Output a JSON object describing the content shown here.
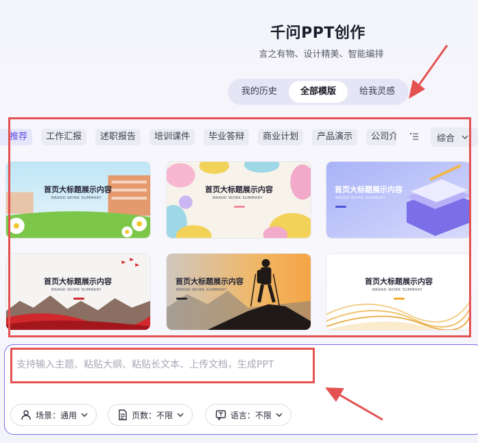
{
  "header": {
    "title": "千问PPT创作",
    "subtitle": "言之有物、设计精美、智能编排"
  },
  "tabs": [
    {
      "label": "我的历史",
      "active": false
    },
    {
      "label": "全部模版",
      "active": true
    },
    {
      "label": "给我灵感",
      "active": false
    }
  ],
  "categories": [
    "推荐",
    "工作汇报",
    "述职报告",
    "培训课件",
    "毕业答辩",
    "商业计划",
    "产品演示",
    "公司介"
  ],
  "sort": {
    "label": "综合"
  },
  "templates": [
    {
      "title": "首页大标题展示内容",
      "subtitle": "BRAND WORK SUMMARY",
      "theme": "school-campus"
    },
    {
      "title": "首页大标题展示内容",
      "subtitle": "BRAND WORK SUMMARY",
      "theme": "pastel-cartoon"
    },
    {
      "title": "首页大标题展示内容",
      "subtitle": "BRAND WORK SUMMARY",
      "theme": "purple-books"
    },
    {
      "title": "首页大标题展示内容",
      "subtitle": "BRAND WORK SUMMARY",
      "theme": "red-mountains"
    },
    {
      "title": "首页大标题展示内容",
      "subtitle": "BRAND WORK SUMMARY",
      "theme": "mountain-hiker"
    },
    {
      "title": "首页大标题展示内容",
      "subtitle": "BRAND WORK SUMMARY",
      "theme": "gold-waves"
    }
  ],
  "composer": {
    "placeholder": "支持输入主题、粘贴大纲、粘贴长文本、上传文档，生成PPT",
    "options": [
      {
        "label": "场景：通用",
        "icon": "user-icon"
      },
      {
        "label": "页数：不限",
        "icon": "document-icon"
      },
      {
        "label": "语言：不限",
        "icon": "language-icon"
      }
    ]
  },
  "colors": {
    "accent": "#5b50e0",
    "annotation": "#e45151",
    "composer_border": "#7a70e8"
  }
}
